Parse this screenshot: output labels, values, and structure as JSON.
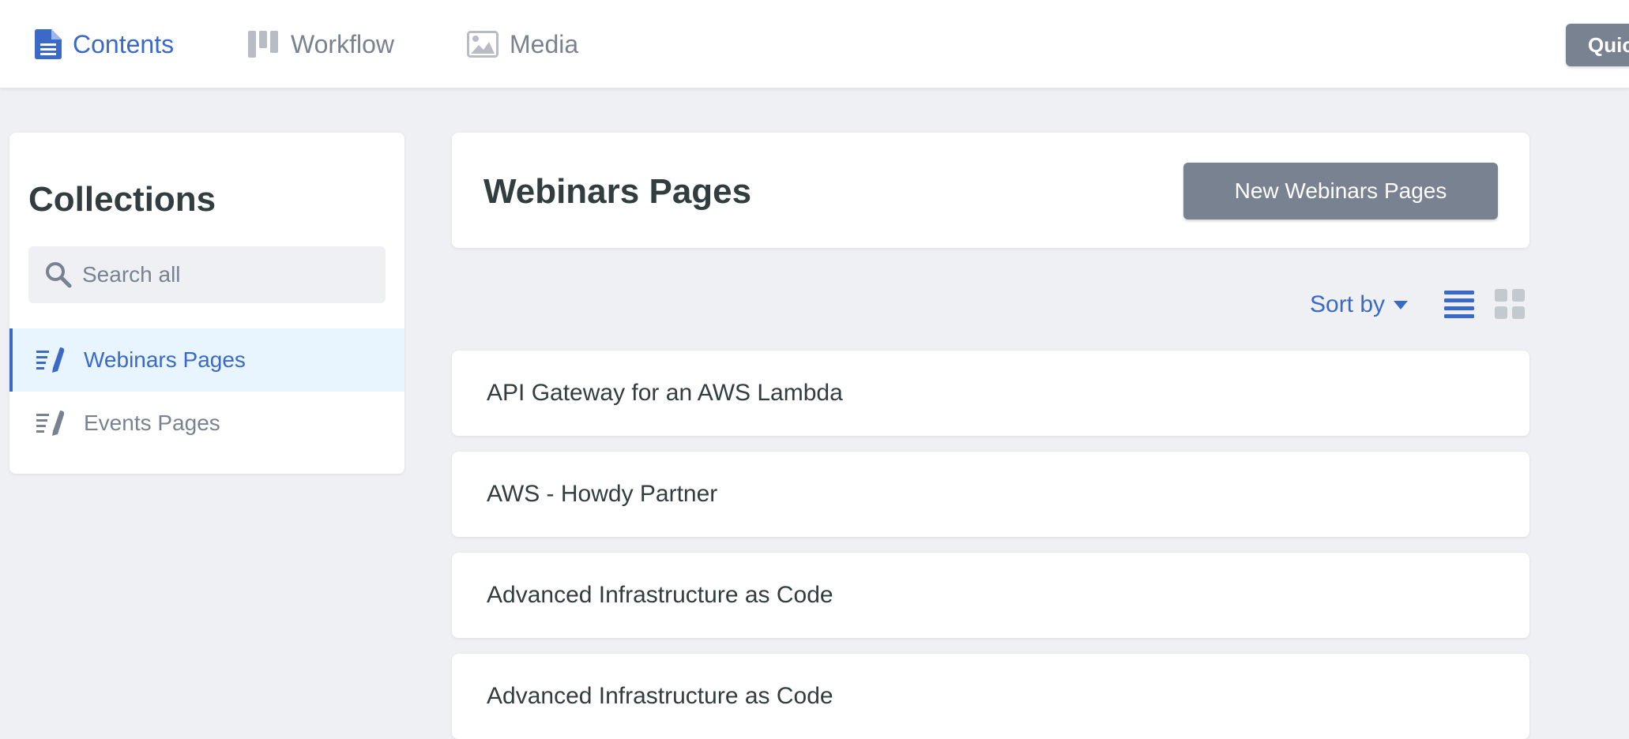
{
  "nav": {
    "tabs": [
      {
        "label": "Contents",
        "icon": "document-icon",
        "active": true
      },
      {
        "label": "Workflow",
        "icon": "kanban-icon",
        "active": false
      },
      {
        "label": "Media",
        "icon": "image-icon",
        "active": false
      }
    ],
    "quick_add_label": "Quic"
  },
  "sidebar": {
    "title": "Collections",
    "search_placeholder": "Search all",
    "items": [
      {
        "label": "Webinars Pages",
        "icon": "write-icon",
        "active": true
      },
      {
        "label": "Events Pages",
        "icon": "write-icon",
        "active": false
      }
    ]
  },
  "main": {
    "title": "Webinars Pages",
    "new_button_label": "New Webinars Pages",
    "sort_label": "Sort by",
    "view_mode": "list",
    "entries": [
      {
        "title": "API Gateway for an AWS Lambda"
      },
      {
        "title": "AWS - Howdy Partner"
      },
      {
        "title": "Advanced Infrastructure as Code"
      },
      {
        "title": "Advanced Infrastructure as Code"
      }
    ]
  },
  "colors": {
    "accent": "#3a69c7",
    "muted": "#798291",
    "background": "#eff0f4",
    "active_item_bg": "#e8f5fe",
    "text": "#313d3e"
  }
}
